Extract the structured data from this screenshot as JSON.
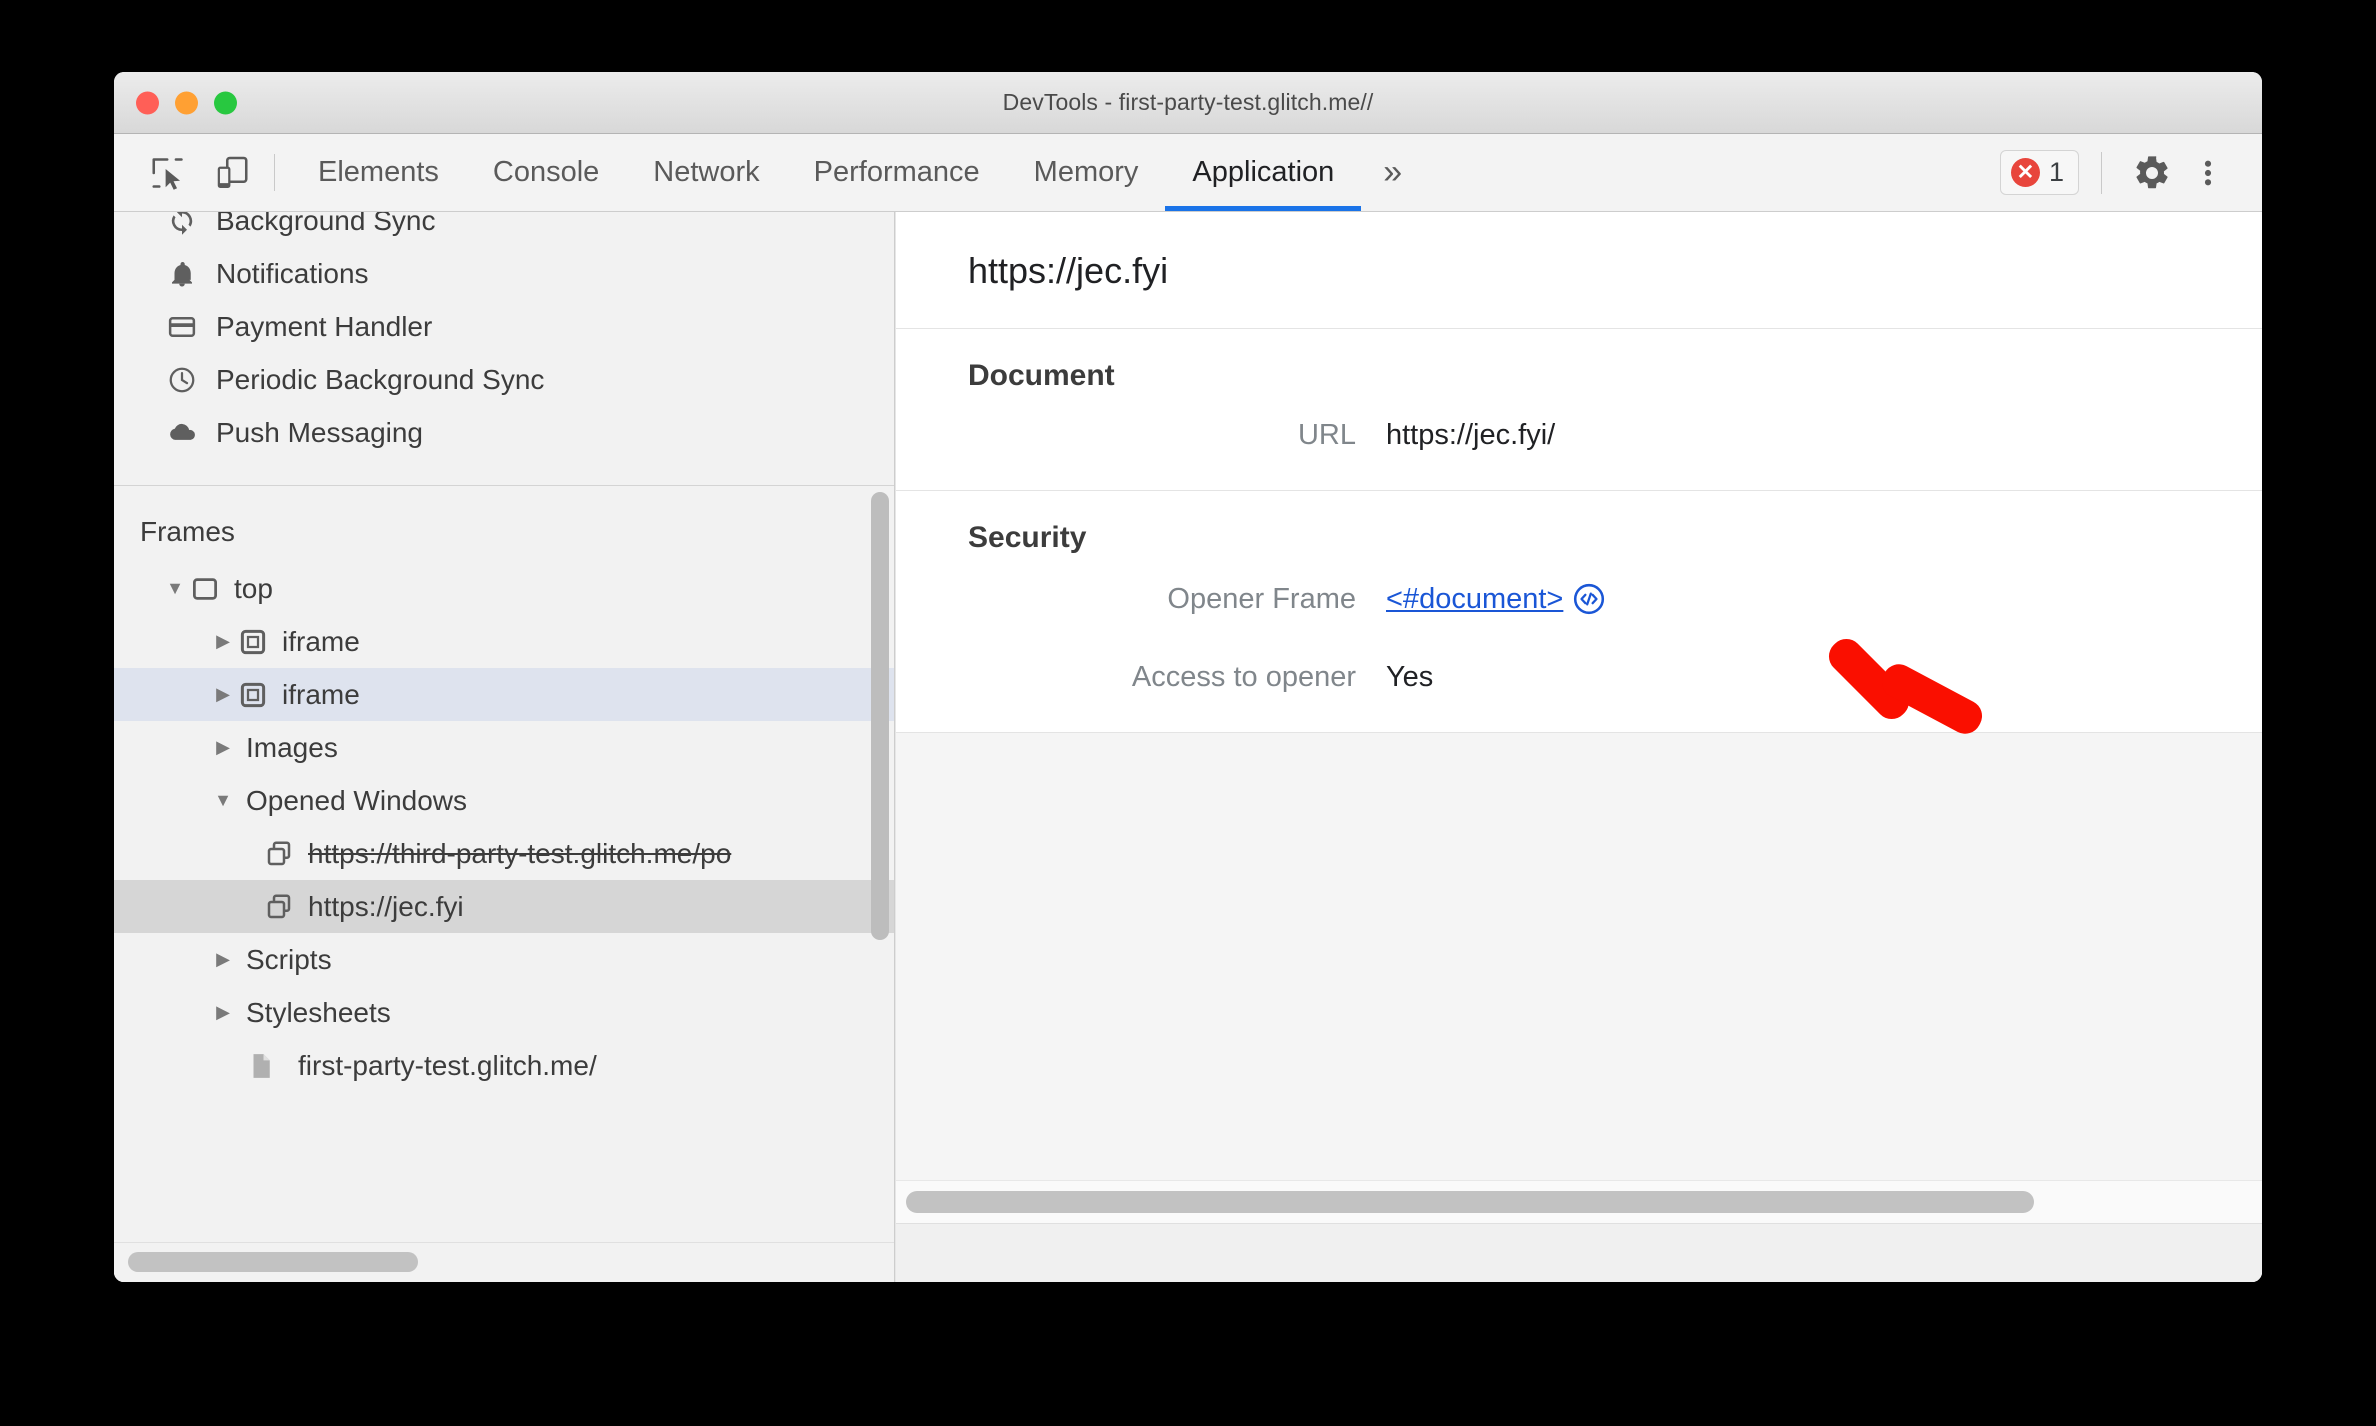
{
  "window": {
    "title": "DevTools - first-party-test.glitch.me//",
    "traffic_lights": [
      "close",
      "minimize",
      "zoom"
    ]
  },
  "toolbar": {
    "inspect_icon": "inspect-element-icon",
    "device_icon": "device-toolbar-icon",
    "tabs": [
      {
        "label": "Elements",
        "active": false
      },
      {
        "label": "Console",
        "active": false
      },
      {
        "label": "Network",
        "active": false
      },
      {
        "label": "Performance",
        "active": false
      },
      {
        "label": "Memory",
        "active": false
      },
      {
        "label": "Application",
        "active": true
      }
    ],
    "more_tabs_label": "»",
    "error_badge": {
      "icon": "error-circle-icon",
      "glyph": "✕",
      "count": "1"
    },
    "settings_icon": "gear-icon",
    "menu_icon": "more-vertical-icon"
  },
  "sidebar": {
    "items": [
      {
        "label": "Background Sync",
        "icon": "background-sync-icon"
      },
      {
        "label": "Notifications",
        "icon": "bell-icon"
      },
      {
        "label": "Payment Handler",
        "icon": "credit-card-icon"
      },
      {
        "label": "Periodic Background Sync",
        "icon": "clock-icon"
      },
      {
        "label": "Push Messaging",
        "icon": "cloud-icon"
      }
    ],
    "frames_title": "Frames",
    "tree": [
      {
        "label": "top",
        "icon": "frame-icon",
        "twisty": "▼",
        "indent": 0,
        "state": "none",
        "strike": false
      },
      {
        "label": "iframe",
        "icon": "iframe-icon",
        "twisty": "▶",
        "indent": 1,
        "state": "none",
        "strike": false
      },
      {
        "label": "iframe",
        "icon": "iframe-icon",
        "twisty": "▶",
        "indent": 1,
        "state": "selected-blue",
        "strike": false
      },
      {
        "label": "Images",
        "icon": "none",
        "twisty": "▶",
        "indent": 1,
        "state": "none",
        "strike": false
      },
      {
        "label": "Opened Windows",
        "icon": "none",
        "twisty": "▼",
        "indent": 1,
        "state": "none",
        "strike": false
      },
      {
        "label": "https://third-party-test.glitch.me/po",
        "icon": "window-icon",
        "twisty": "",
        "indent": 2,
        "state": "none",
        "strike": true
      },
      {
        "label": "https://jec.fyi",
        "icon": "window-icon",
        "twisty": "",
        "indent": 2,
        "state": "selected-gray",
        "strike": false
      },
      {
        "label": "Scripts",
        "icon": "none",
        "twisty": "▶",
        "indent": 1,
        "state": "none",
        "strike": false
      },
      {
        "label": "Stylesheets",
        "icon": "none",
        "twisty": "▶",
        "indent": 1,
        "state": "none",
        "strike": false
      },
      {
        "label": "first-party-test.glitch.me/",
        "icon": "document-icon",
        "twisty": "",
        "indent": 2,
        "state": "none",
        "strike": false
      }
    ]
  },
  "main": {
    "frame_header": "https://jec.fyi",
    "sections": [
      {
        "title": "Document",
        "rows": [
          {
            "key": "URL",
            "value": "https://jec.fyi/",
            "type": "text"
          }
        ]
      },
      {
        "title": "Security",
        "rows": [
          {
            "key": "Opener Frame",
            "value": "<#document>",
            "type": "link",
            "trailing_icon": "code-reveal-icon"
          },
          {
            "key": "Access to opener",
            "value": "Yes",
            "type": "text"
          }
        ]
      }
    ]
  },
  "annotation": {
    "arrow": "red-arrow-pointing-down-left",
    "color": "#fa0f00"
  },
  "colors": {
    "accent": "#1a73e8",
    "link": "#1a56d6",
    "error": "#e8453c",
    "selected_blue": "#dee3ee",
    "selected_gray": "#d6d6d6",
    "annotation_red": "#fa0f00"
  }
}
